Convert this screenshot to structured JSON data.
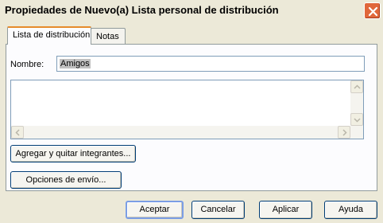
{
  "window": {
    "title": "Propiedades de Nuevo(a) Lista personal de distribución",
    "close_icon": "close-icon"
  },
  "tabs": [
    {
      "label": "Lista de distribución",
      "selected": true
    },
    {
      "label": "Notas",
      "selected": false
    }
  ],
  "form": {
    "nombre_label": "Nombre:",
    "nombre_value": "Amigos",
    "members_list": []
  },
  "actions": {
    "agregar_label": "Agregar y quitar integrantes...",
    "opciones_label": "Opciones de envío..."
  },
  "footer": {
    "aceptar_label": "Aceptar",
    "cancelar_label": "Cancelar",
    "aplicar_label": "Aplicar",
    "ayuda_label": "Ayuda"
  },
  "colors": {
    "dialog_bg": "#ece9d8",
    "close_button": "#e0673b",
    "tab_accent": "#e68b2c",
    "input_border": "#7f9db9"
  }
}
